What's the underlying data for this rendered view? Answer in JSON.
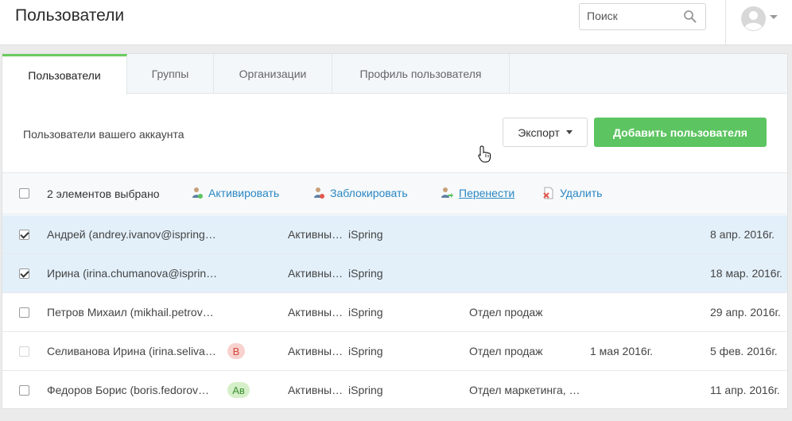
{
  "header": {
    "title": "Пользователи",
    "search_placeholder": "Поиск"
  },
  "tabs": [
    {
      "label": "Пользователи",
      "active": true
    },
    {
      "label": "Группы",
      "active": false
    },
    {
      "label": "Организации",
      "active": false
    },
    {
      "label": "Профиль пользователя",
      "active": false
    }
  ],
  "toolbar": {
    "subtitle": "Пользователи вашего аккаунта",
    "export_label": "Экспорт",
    "add_label": "Добавить пользователя"
  },
  "actionbar": {
    "selected_text": "2 элементов выбрано",
    "activate": "Активировать",
    "block": "Заблокировать",
    "move": "Перенести",
    "delete": "Удалить"
  },
  "rows": [
    {
      "name": "Андрей (andrey.ivanov@ispring…",
      "status": "Активны…",
      "org": "iSpring",
      "dept": "",
      "date1": "",
      "date2": "8 апр. 2016г.",
      "checked": true,
      "badge": ""
    },
    {
      "name": "Ирина (irina.chumanova@isprin…",
      "status": "Активны…",
      "org": "iSpring",
      "dept": "",
      "date1": "",
      "date2": "18 мар. 2016г.",
      "checked": true,
      "badge": ""
    },
    {
      "name": "Петров Михаил (mikhail.petrov…",
      "status": "Активны…",
      "org": "iSpring",
      "dept": "Отдел продаж",
      "date1": "",
      "date2": "29 апр. 2016г.",
      "checked": false,
      "badge": ""
    },
    {
      "name": "Селиванова Ирина (irina.seliva…",
      "status": "Активны…",
      "org": "iSpring",
      "dept": "Отдел продаж",
      "date1": "1 мая 2016г.",
      "date2": "5 фев. 2016г.",
      "checked": false,
      "badge": "В"
    },
    {
      "name": "Федоров Борис (boris.fedorov…",
      "status": "Активны…",
      "org": "iSpring",
      "dept": "Отдел маркетинга, …",
      "date1": "",
      "date2": "11 апр. 2016г.",
      "checked": false,
      "badge": "Ав"
    }
  ],
  "colors": {
    "accent_green": "#5cc460",
    "link_blue": "#2a87c2",
    "selected_row": "#e3f0fa"
  }
}
